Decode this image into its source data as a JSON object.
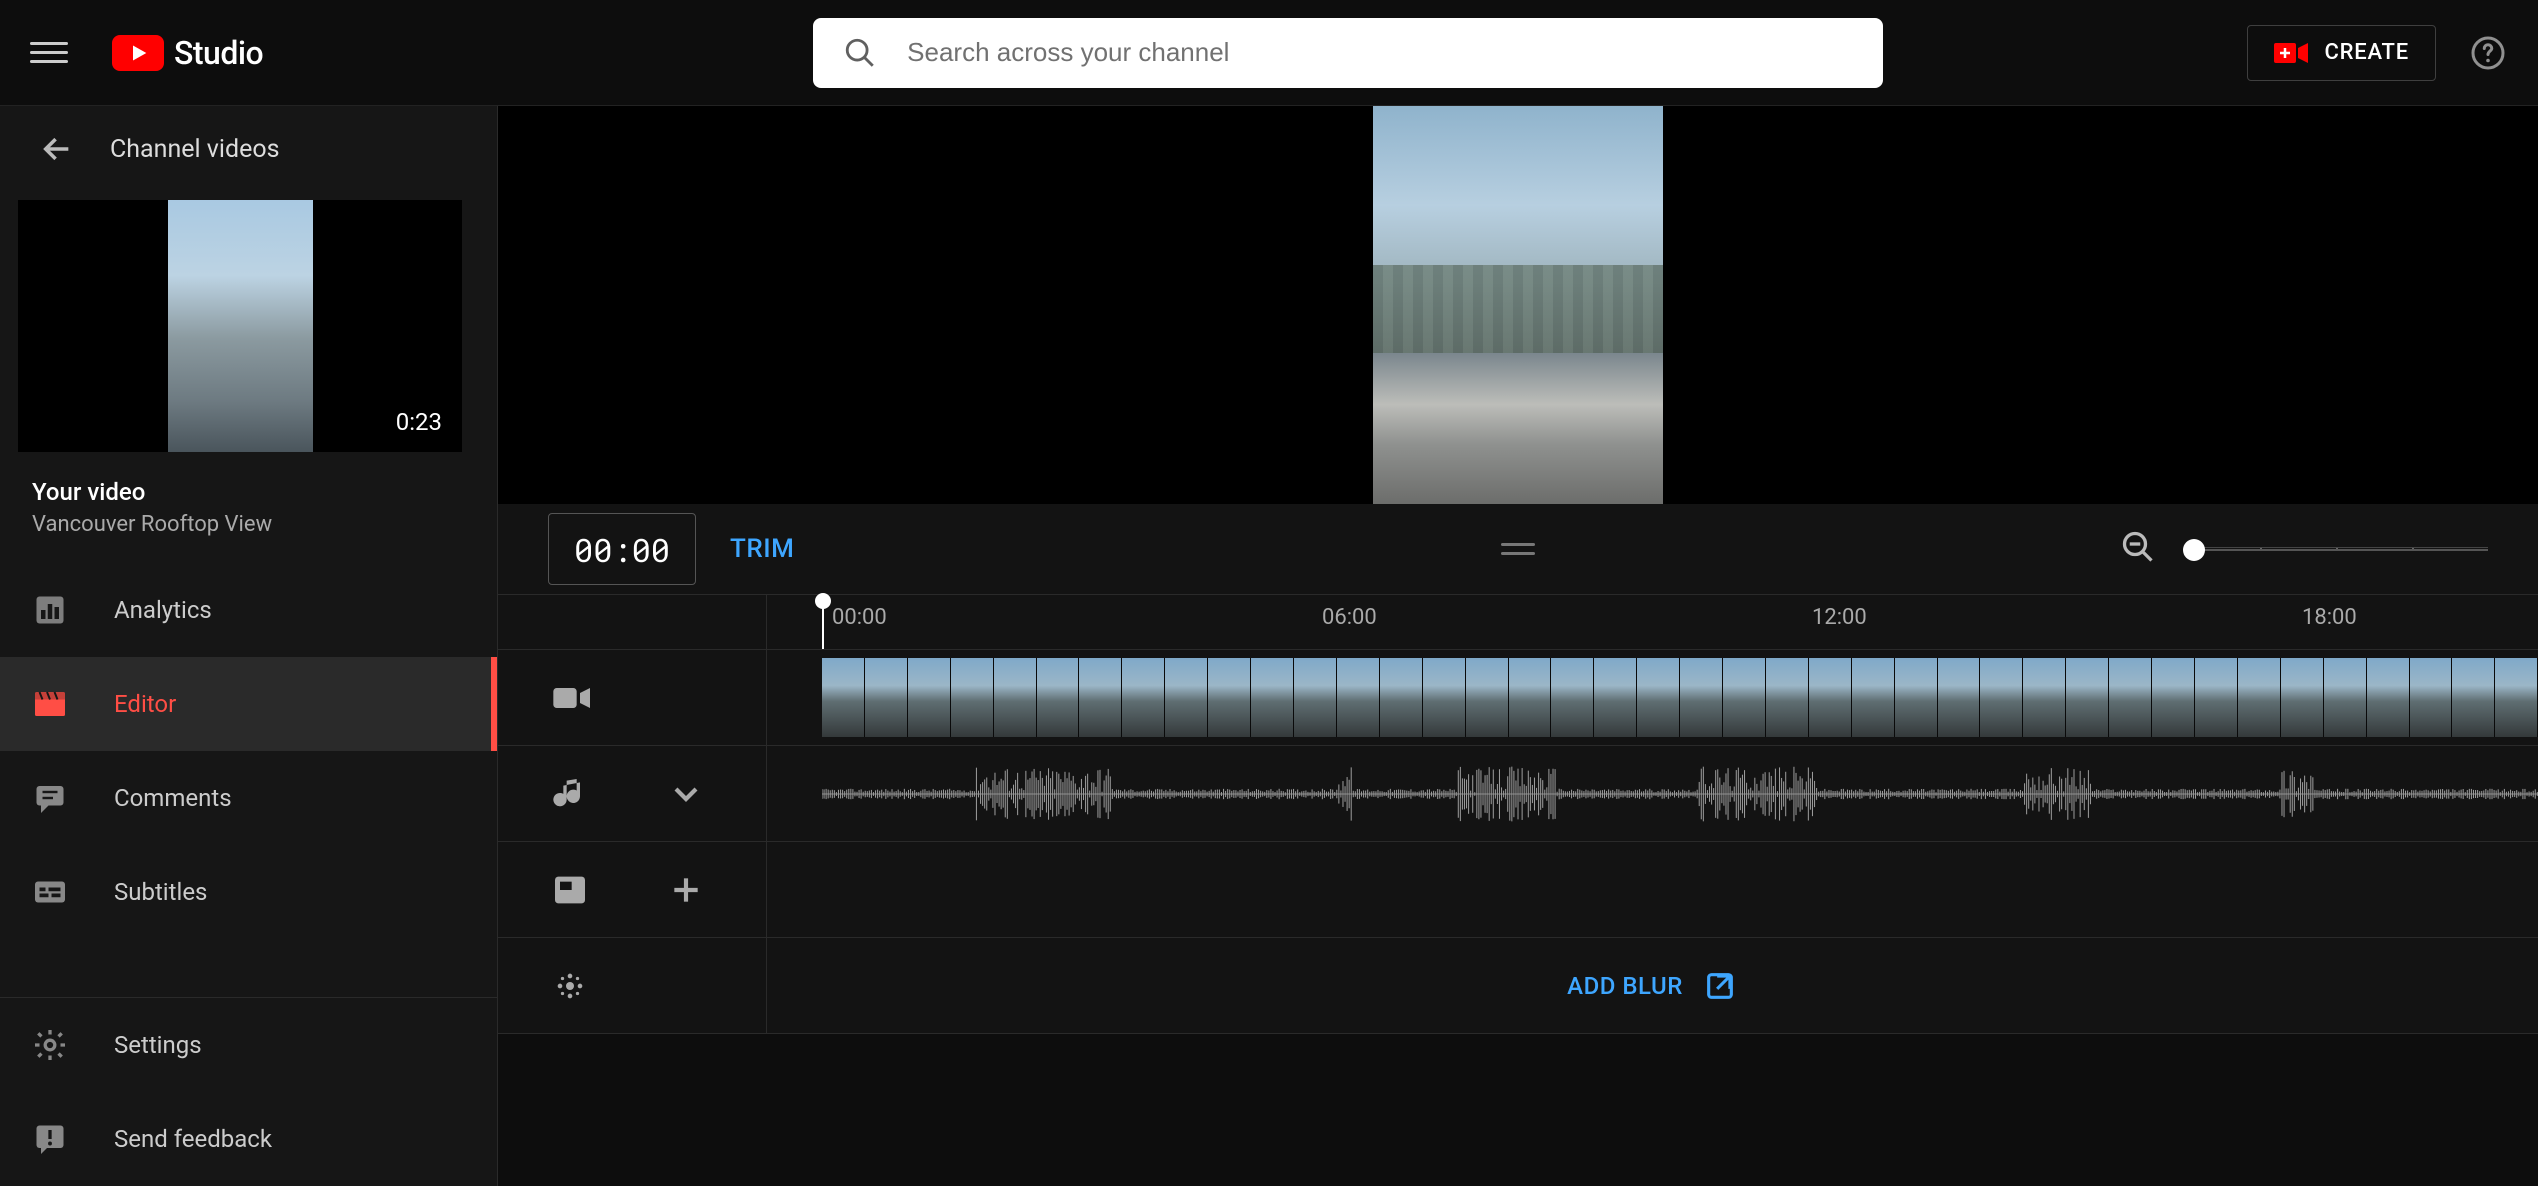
{
  "brand": {
    "word": "Studio"
  },
  "header": {
    "search_placeholder": "Search across your channel",
    "create_label": "CREATE"
  },
  "breadcrumb": {
    "label": "Channel videos"
  },
  "thumbnail": {
    "duration": "0:23"
  },
  "video_meta": {
    "label": "Your video",
    "title": "Vancouver Rooftop View"
  },
  "sidebar": {
    "items": [
      {
        "label": "Analytics",
        "icon": "analytics",
        "active": false
      },
      {
        "label": "Editor",
        "icon": "editor",
        "active": true
      },
      {
        "label": "Comments",
        "icon": "comments",
        "active": false
      },
      {
        "label": "Subtitles",
        "icon": "subtitles",
        "active": false
      }
    ],
    "bottom": [
      {
        "label": "Settings",
        "icon": "settings"
      },
      {
        "label": "Send feedback",
        "icon": "feedback"
      }
    ]
  },
  "editor": {
    "timecode": "00:00",
    "trim_label": "TRIM",
    "add_blur_label": "ADD BLUR",
    "ruler_ticks": [
      "00:00",
      "06:00",
      "12:00",
      "18:00"
    ]
  }
}
